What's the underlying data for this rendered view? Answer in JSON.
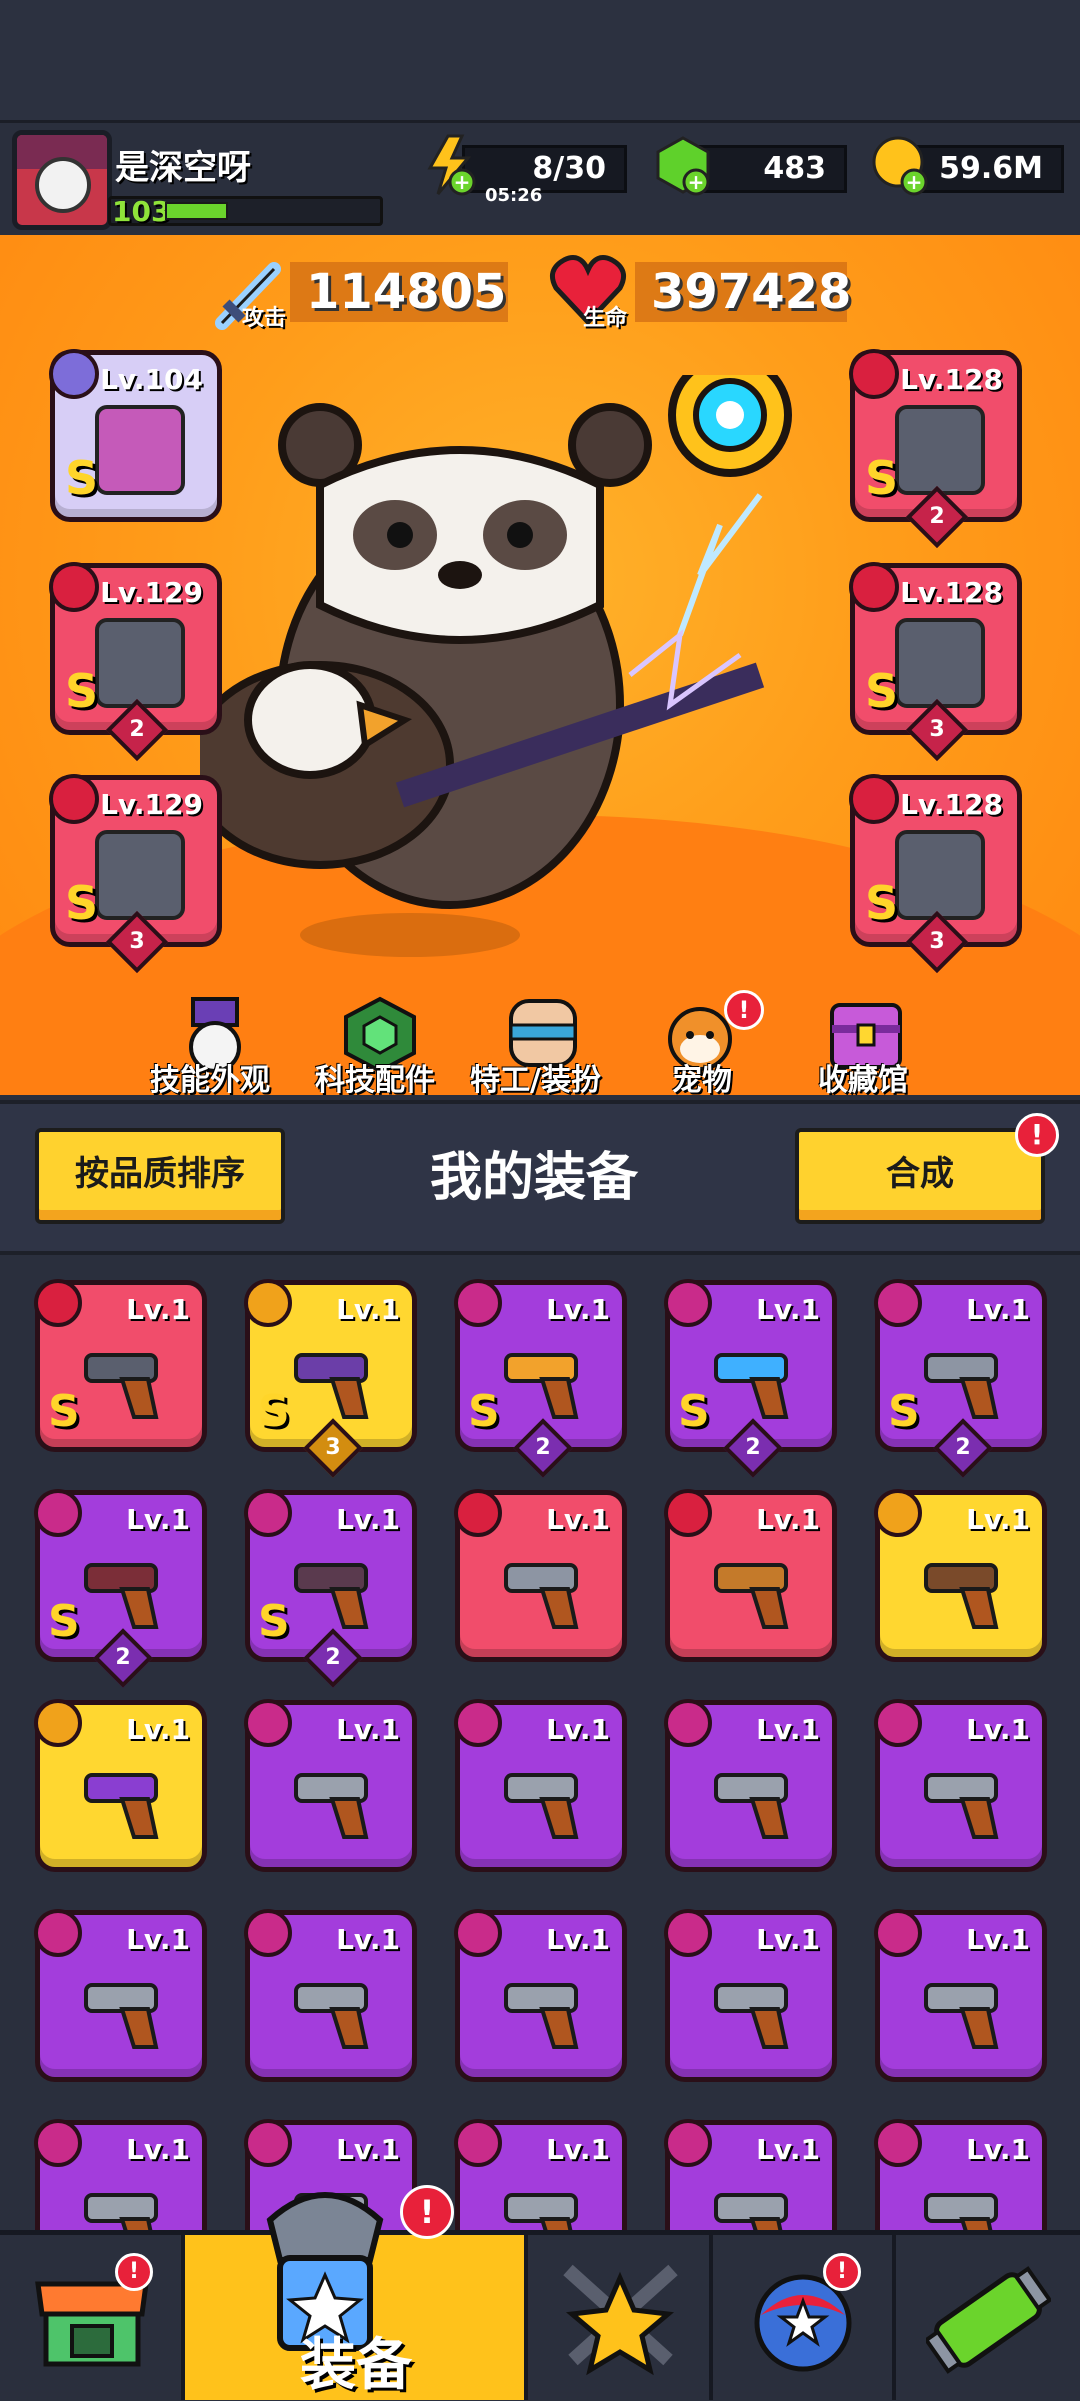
{
  "player": {
    "name": "是深空呀",
    "level": "103",
    "level_progress": 0.3
  },
  "resources": [
    {
      "value": "8/30",
      "sub": "05:26",
      "icon": "lightning-icon"
    },
    {
      "value": "483",
      "icon": "gem-icon"
    },
    {
      "value": "59.6M",
      "icon": "coin-icon"
    }
  ],
  "stats": {
    "attack": {
      "value": "114805",
      "label": "攻击"
    },
    "health": {
      "value": "397428",
      "label": "生命"
    }
  },
  "equipped": {
    "left": [
      {
        "lv": "Lv.104",
        "grade": "S",
        "stars": ""
      },
      {
        "lv": "Lv.129",
        "grade": "S",
        "stars": "2"
      },
      {
        "lv": "Lv.129",
        "grade": "S",
        "stars": "3"
      }
    ],
    "right": [
      {
        "lv": "Lv.128",
        "grade": "S",
        "stars": "2"
      },
      {
        "lv": "Lv.128",
        "grade": "S",
        "stars": "3"
      },
      {
        "lv": "Lv.128",
        "grade": "S",
        "stars": "3"
      }
    ]
  },
  "menu": [
    {
      "label": "技能外观"
    },
    {
      "label": "科技配件"
    },
    {
      "label": "特工/装扮"
    },
    {
      "label": "宠物",
      "alert": "!"
    },
    {
      "label": "收藏馆"
    }
  ],
  "bag": {
    "sort_label": "按品质排序",
    "title": "我的装备",
    "merge_label": "合成",
    "merge_alert": "!"
  },
  "inventory": [
    {
      "lv": "Lv.1",
      "grade": "S",
      "stars": "",
      "color": "red"
    },
    {
      "lv": "Lv.1",
      "grade": "S",
      "stars": "3",
      "color": "yellow"
    },
    {
      "lv": "Lv.1",
      "grade": "S",
      "stars": "2",
      "color": "purple"
    },
    {
      "lv": "Lv.1",
      "grade": "S",
      "stars": "2",
      "color": "purple"
    },
    {
      "lv": "Lv.1",
      "grade": "S",
      "stars": "2",
      "color": "purple"
    },
    {
      "lv": "Lv.1",
      "grade": "S",
      "stars": "2",
      "color": "purple"
    },
    {
      "lv": "Lv.1",
      "grade": "S",
      "stars": "2",
      "color": "purple"
    },
    {
      "lv": "Lv.1",
      "grade": "",
      "stars": "",
      "color": "red"
    },
    {
      "lv": "Lv.1",
      "grade": "",
      "stars": "",
      "color": "red"
    },
    {
      "lv": "Lv.1",
      "grade": "",
      "stars": "",
      "color": "yellow"
    },
    {
      "lv": "Lv.1",
      "grade": "",
      "stars": "",
      "color": "yellow"
    },
    {
      "lv": "Lv.1",
      "grade": "",
      "stars": "",
      "color": "purple"
    },
    {
      "lv": "Lv.1",
      "grade": "",
      "stars": "",
      "color": "purple"
    },
    {
      "lv": "Lv.1",
      "grade": "",
      "stars": "",
      "color": "purple"
    },
    {
      "lv": "Lv.1",
      "grade": "",
      "stars": "",
      "color": "purple"
    },
    {
      "lv": "Lv.1",
      "grade": "",
      "stars": "",
      "color": "purple"
    },
    {
      "lv": "Lv.1",
      "grade": "",
      "stars": "",
      "color": "purple"
    },
    {
      "lv": "Lv.1",
      "grade": "",
      "stars": "",
      "color": "purple"
    },
    {
      "lv": "Lv.1",
      "grade": "",
      "stars": "",
      "color": "purple"
    },
    {
      "lv": "Lv.1",
      "grade": "",
      "stars": "",
      "color": "purple"
    },
    {
      "lv": "Lv.1",
      "grade": "",
      "stars": "",
      "color": "purple"
    },
    {
      "lv": "Lv.1",
      "grade": "",
      "stars": "",
      "color": "purple"
    },
    {
      "lv": "Lv.1",
      "grade": "",
      "stars": "",
      "color": "purple"
    },
    {
      "lv": "Lv.1",
      "grade": "",
      "stars": "",
      "color": "purple"
    },
    {
      "lv": "Lv.1",
      "grade": "",
      "stars": "",
      "color": "purple"
    }
  ],
  "nav": {
    "active_label": "装备",
    "alerts": [
      "!",
      "!",
      "!"
    ]
  },
  "colors": {
    "accent": "#ffc21b",
    "alert": "#e8213a",
    "rare_purple": "#a33ddc",
    "epic_red": "#f14d6b",
    "legend_yellow": "#ffd730"
  }
}
